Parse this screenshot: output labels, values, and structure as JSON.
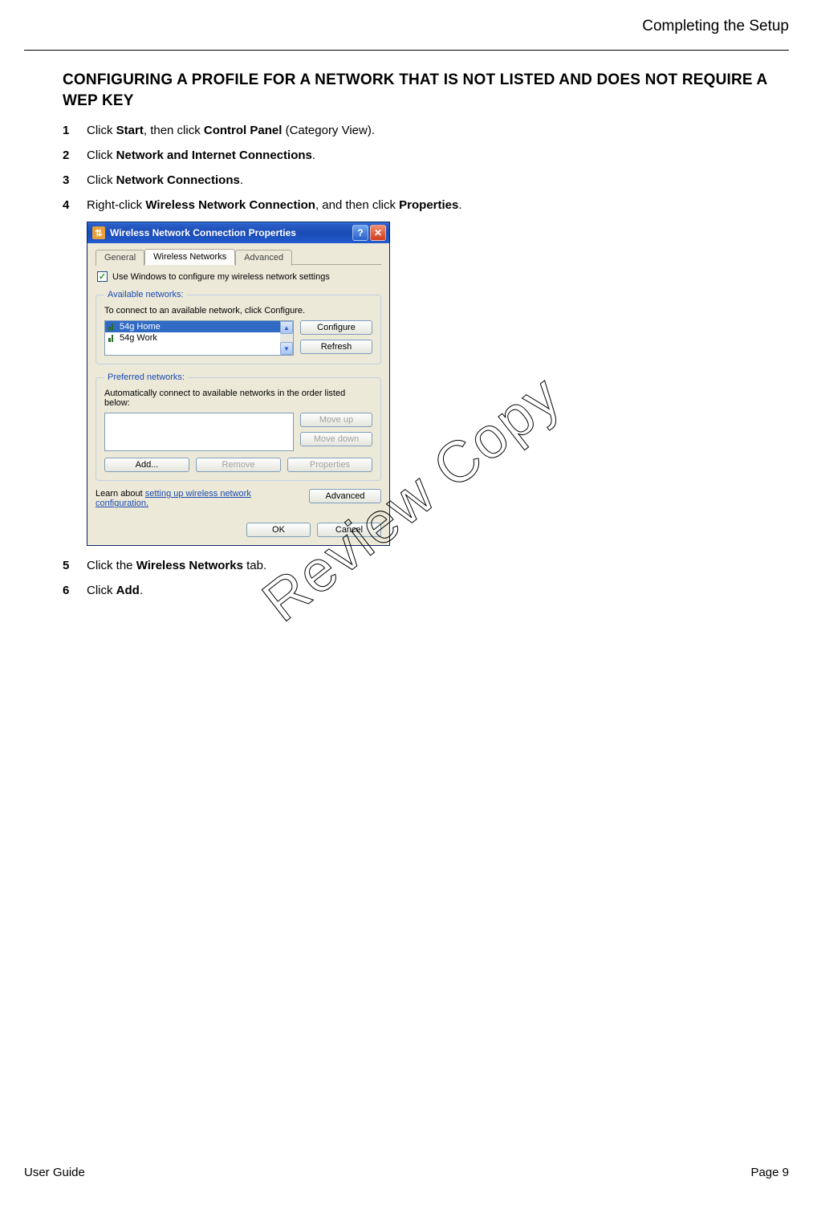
{
  "header": {
    "section": "Completing the Setup"
  },
  "title": "CONFIGURING A PROFILE FOR A NETWORK THAT IS NOT LISTED AND DOES NOT REQUIRE A WEP KEY",
  "steps": {
    "s1": {
      "num": "1",
      "pre": "Click ",
      "b1": "Start",
      "mid": ", then click ",
      "b2": "Control Panel",
      "post": " (Category View)."
    },
    "s2": {
      "num": "2",
      "pre": "Click ",
      "b1": "Network and Internet Connections",
      "post": "."
    },
    "s3": {
      "num": "3",
      "pre": "Click ",
      "b1": "Network Connections",
      "post": "."
    },
    "s4": {
      "num": "4",
      "pre": "Right-click ",
      "b1": "Wireless Network Connection",
      "mid": ", and then click ",
      "b2": "Properties",
      "post": "."
    },
    "s5": {
      "num": "5",
      "pre": "Click the ",
      "b1": "Wireless Networks",
      "post": " tab."
    },
    "s6": {
      "num": "6",
      "pre": "Click ",
      "b1": "Add",
      "post": "."
    }
  },
  "dialog": {
    "title": "Wireless Network Connection Properties",
    "tabs": {
      "general": "General",
      "wireless": "Wireless Networks",
      "advanced": "Advanced"
    },
    "checkbox": "Use Windows to configure my wireless network settings",
    "available": {
      "legend": "Available networks:",
      "hint": "To connect to an available network, click Configure.",
      "item1": "54g Home",
      "item2": "54g  Work",
      "configure": "Configure",
      "refresh": "Refresh"
    },
    "preferred": {
      "legend": "Preferred networks:",
      "hint": "Automatically connect to available networks in the order listed below:",
      "moveup": "Move up",
      "movedown": "Move down",
      "add": "Add...",
      "remove": "Remove",
      "properties": "Properties"
    },
    "learn_pre": "Learn about ",
    "learn_link": "setting up wireless network configuration.",
    "advanced_btn": "Advanced",
    "ok": "OK",
    "cancel": "Cancel"
  },
  "watermark": "Review Copy",
  "footer": {
    "left": "User Guide",
    "right": "Page  9"
  }
}
